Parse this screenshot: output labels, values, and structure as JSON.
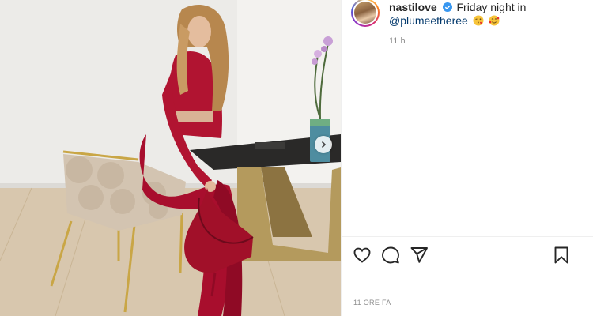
{
  "post": {
    "username": "nastilove",
    "caption": "Friday night in",
    "mention": "@plumeetheree",
    "emojis": [
      "kiss-face-emoji",
      "smiling-face-hearts-emoji"
    ],
    "relative_time": "11 h",
    "date_label": "11 ORE FA"
  },
  "icons": {
    "verified": "verified-badge-icon",
    "like": "heart-icon",
    "comment": "comment-bubble-icon",
    "share": "paper-plane-icon",
    "save": "bookmark-icon",
    "next": "chevron-right-icon"
  },
  "colors": {
    "verified": "#3897f0",
    "mention": "#00376b",
    "muted": "#8e8e8e",
    "text": "#262626"
  }
}
